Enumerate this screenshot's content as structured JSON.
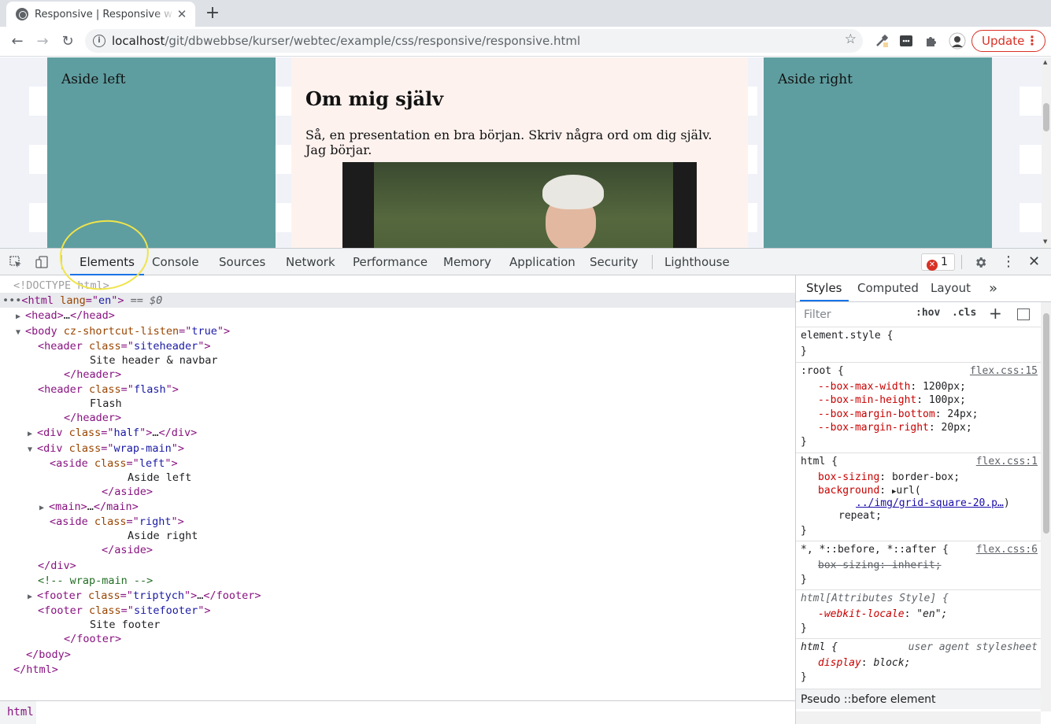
{
  "browser": {
    "tab_title": "Responsive | Responsive w",
    "url_host": "localhost",
    "url_path": "/git/dbwebbse/kurser/webtec/example/css/responsive/responsive.html",
    "update_label": "Update"
  },
  "page": {
    "aside_left": "Aside left",
    "aside_right": "Aside right",
    "heading": "Om mig själv",
    "paragraph": "Så, en presentation en bra början. Skriv några ord om dig själv. Jag börjar."
  },
  "devtools": {
    "tabs": [
      "Elements",
      "Console",
      "Sources",
      "Network",
      "Performance",
      "Memory",
      "Application",
      "Security",
      "Lighthouse"
    ],
    "error_count": "1",
    "dom": {
      "doctype": "<!DOCTYPE html>",
      "html_tag": "html",
      "html_attr": "lang",
      "html_val": "en",
      "selected_marker": "== $0",
      "head": "head",
      "body_attr": "cz-shortcut-listen",
      "body_val": "true",
      "siteheader_class": "siteheader",
      "siteheader_text": "Site header & navbar",
      "flash_class": "flash",
      "flash_text": "Flash",
      "half_class": "half",
      "wrap_class": "wrap-main",
      "left_class": "left",
      "aside_left_text": "Aside left",
      "right_class": "right",
      "aside_right_text": "Aside right",
      "comment": "<!-- wrap-main -->",
      "triptych_class": "triptych",
      "sitefooter_class": "sitefooter",
      "footer_text": "Site footer"
    },
    "breadcrumb": "html",
    "sidebar_tabs": [
      "Styles",
      "Computed",
      "Layout"
    ],
    "filter_placeholder": "Filter",
    "hov": ":hov",
    "cls": ".cls",
    "styles": {
      "element_style": "element.style {",
      "root_selector": ":root",
      "root_src": "flex.css:15",
      "root_props": [
        {
          "name": "--box-max-width",
          "value": "1200px;"
        },
        {
          "name": "--box-min-height",
          "value": "100px;"
        },
        {
          "name": "--box-margin-bottom",
          "value": "24px;"
        },
        {
          "name": "--box-margin-right",
          "value": "20px;"
        }
      ],
      "html_selector": "html",
      "html_src": "flex.css:1",
      "box_sizing_name": "box-sizing",
      "box_sizing_value": "border-box;",
      "background_name": "background",
      "background_value": "url(",
      "background_url": "../img/grid-square-20.p…",
      "background_repeat": "repeat;",
      "universal_selector": "*, *::before, *::after",
      "universal_src": "flex.css:6",
      "universal_prop": "box-sizing: inherit;",
      "attr_style_selector": "html[Attributes Style] {",
      "webkit_locale_name": "-webkit-locale",
      "webkit_locale_value": "\"en\";",
      "ua_selector": "html",
      "ua_src": "user agent stylesheet",
      "display_name": "display",
      "display_value": "block;"
    },
    "pseudo_label": "Pseudo ::before element"
  },
  "colors": {
    "aside": "#5f9ea0",
    "main_bg": "#fdf2ee",
    "accent": "#1a73e8",
    "annotation": "#f0e44a"
  }
}
